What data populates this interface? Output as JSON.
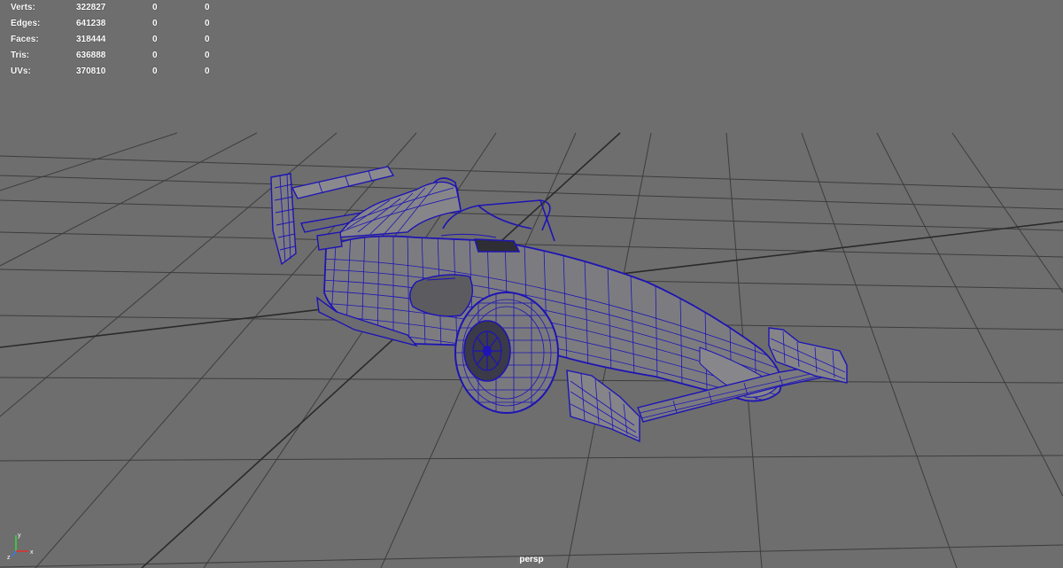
{
  "hud": {
    "rows": [
      {
        "label": "Verts:",
        "total": "322827",
        "selected": "0",
        "component": "0"
      },
      {
        "label": "Edges:",
        "total": "641238",
        "selected": "0",
        "component": "0"
      },
      {
        "label": "Faces:",
        "total": "318444",
        "selected": "0",
        "component": "0"
      },
      {
        "label": "Tris:",
        "total": "636888",
        "selected": "0",
        "component": "0"
      },
      {
        "label": "UVs:",
        "total": "370810",
        "selected": "0",
        "component": "0"
      }
    ]
  },
  "viewport": {
    "camera": "persp",
    "background_color": "#6e6e6e",
    "grid_color": "#3a3a3a",
    "wire_color": "#1e14b4",
    "surface_color": "#7c7c80"
  },
  "axis_gizmo": {
    "x": "x",
    "y": "y",
    "z": "z"
  }
}
